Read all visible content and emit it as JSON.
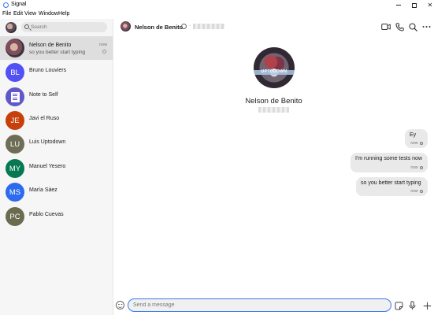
{
  "window": {
    "title": "Signal"
  },
  "menu": [
    "File",
    "Edit",
    "View",
    "Window",
    "Help"
  ],
  "sidebar": {
    "search_placeholder": "Search",
    "conversations": [
      {
        "name": "Nelson de Benito",
        "preview": "so you better start typing",
        "time": "now",
        "initials": "",
        "color": "#6b5864",
        "active": true
      },
      {
        "name": "Bruno Louviers",
        "initials": "BL",
        "color": "#5151f6"
      },
      {
        "name": "Note to Self",
        "initials": "",
        "color": "#6058ca",
        "icon": "note-icon"
      },
      {
        "name": "Javi el Ruso",
        "initials": "JE",
        "color": "#c73f0a"
      },
      {
        "name": "Luis Uptodown",
        "initials": "LU",
        "color": "#6e6e56"
      },
      {
        "name": "Manuel Yesero",
        "initials": "MY",
        "color": "#067953"
      },
      {
        "name": "María Sáez",
        "initials": "MS",
        "color": "#2c6bed"
      },
      {
        "name": "Pablo Cuevas",
        "initials": "PC",
        "color": "#6b6b50"
      }
    ]
  },
  "conversation_header": {
    "name": "Nelson de Benito",
    "separator": "·"
  },
  "profile": {
    "name": "Nelson de Benito",
    "avatar_caption": "UPTODOWN"
  },
  "messages": [
    {
      "text": "Ey",
      "time": "now"
    },
    {
      "text": "I'm running some tests now",
      "time": "now"
    },
    {
      "text": "so you better start typing",
      "time": "now"
    }
  ],
  "composer": {
    "placeholder": "Send a message"
  },
  "icons": {
    "header": [
      "video-call-icon",
      "phone-call-icon",
      "search-icon",
      "more-icon"
    ],
    "composer": [
      "emoji-icon",
      "sticker-icon",
      "microphone-icon",
      "plus-icon"
    ]
  },
  "colors": {
    "accent": "#3a76f0",
    "sidebar_bg": "#f6f6f6",
    "active_row": "#dedede",
    "bubble_bg": "#e9e9e9"
  }
}
